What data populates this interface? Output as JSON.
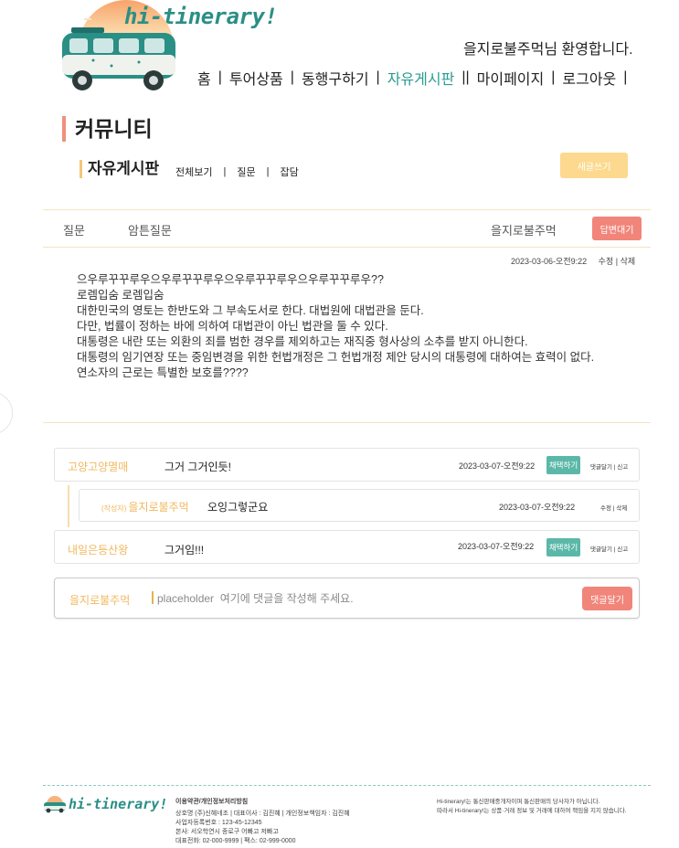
{
  "header": {
    "logo_text": "hi-tinerary!",
    "welcome": "을지로불주먹님 환영합니다.",
    "nav": [
      "홈",
      "투어상품",
      "동행구하기",
      "자유게시판",
      "마이페이지",
      "로그아웃"
    ],
    "nav_active": "자유게시판"
  },
  "page": {
    "title": "커뮤니티",
    "board_title": "자유게시판",
    "board_tabs": [
      "전체보기",
      "질문",
      "잡담"
    ],
    "write_button": "새글쓰기"
  },
  "post": {
    "category": "질문",
    "title": "암튼질문",
    "author": "을지로불주먹",
    "status_button": "답변대기",
    "date": "2023-03-06-오전9:22",
    "edit_label": "수정",
    "delete_label": "삭제",
    "body": [
      "으우루꾸꾸루우으우루꾸꾸루우으우루꾸꾸루우으우루꾸꾸루우??",
      "로렘입숨 로렘입숨",
      "대한민국의 영토는 한반도와 그 부속도서로 한다. 대법원에 대법관을 둔다.",
      "다만, 법률이 정하는 바에 의하여 대법관이 아닌 법관을 둘 수 있다.",
      "대통령은 내란 또는 외환의 죄를 범한 경우를 제외하고는 재직중 형사상의 소추를 받지 아니한다.",
      "대통령의 임기연장 또는 중임변경을 위한 헌법개정은 그 헌법개정 제안 당시의 대통령에 대하여는 효력이 없다.",
      "연소자의 근로는 특별한 보호를????"
    ]
  },
  "comments": [
    {
      "author": "고양고양멸매",
      "text": "그거 그거인듯!",
      "date": "2023-03-07-오전9:22",
      "adopt_label": "채택하기",
      "links": "댓글달기 | 신고"
    },
    {
      "author_tag": "(작성자)",
      "author": "을지로불주먹",
      "text": "오잉그렇군요",
      "date": "2023-03-07-오전9:22",
      "links": "수정 | 삭제"
    },
    {
      "author": "내일은등산왕",
      "text": "그거임!!!",
      "date": "2023-03-07-오전9:22",
      "adopt_label": "채택하기",
      "links": "댓글달기 | 신고"
    }
  ],
  "comment_form": {
    "author": "을지로불주먹",
    "placeholder": "placeholder  여기에 댓글을 작성해 주세요.",
    "submit_label": "댓글달기"
  },
  "footer": {
    "logo_text": "hi-tinerary!",
    "info_title": "이용약관/개인정보처리방침",
    "info_lines": [
      "상호명 (주)신혜네조  |  대표이사 : 김진혜  |  개인정보책임자 : 김진혜",
      "사업자등록번호 : 123-45-12345",
      "본사: 서오학연시 종로구 어빠고 저빠고",
      "대표전화: 02-000-9999 |  팩스: 02-999-0000"
    ],
    "note_lines": [
      "Hi-tinerary!는 통신판매중개자이며 통신판매의 당사자가 아닙니다.",
      "따라서 Hi-tinerary!는 상품·거래 정보 및 거래에 대하여 책임을 지지 않습니다."
    ]
  },
  "colors": {
    "accent_teal": "#2a9d8f",
    "accent_coral": "#f1857a",
    "accent_yellow": "#fcd98f",
    "author_orange": "#f0b85e"
  }
}
